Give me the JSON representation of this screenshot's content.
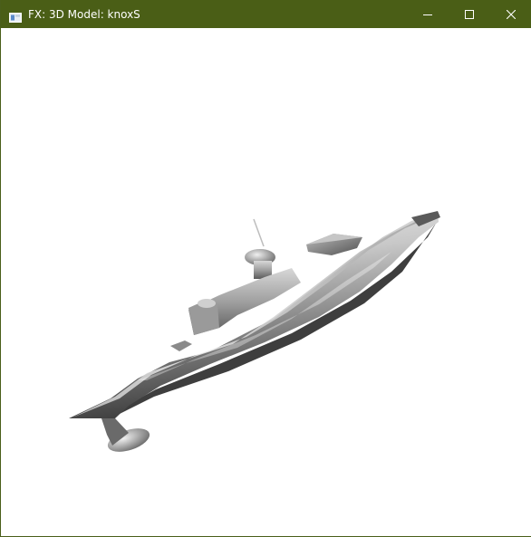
{
  "window": {
    "title": "FX: 3D Model: knoxS",
    "titlebar_color": "#4a5e16",
    "controls": {
      "minimize_icon": "minimize-icon",
      "maximize_icon": "maximize-icon",
      "close_icon": "close-icon"
    }
  },
  "viewport": {
    "background": "#ffffff",
    "model_icon": "ship-3d-model"
  }
}
